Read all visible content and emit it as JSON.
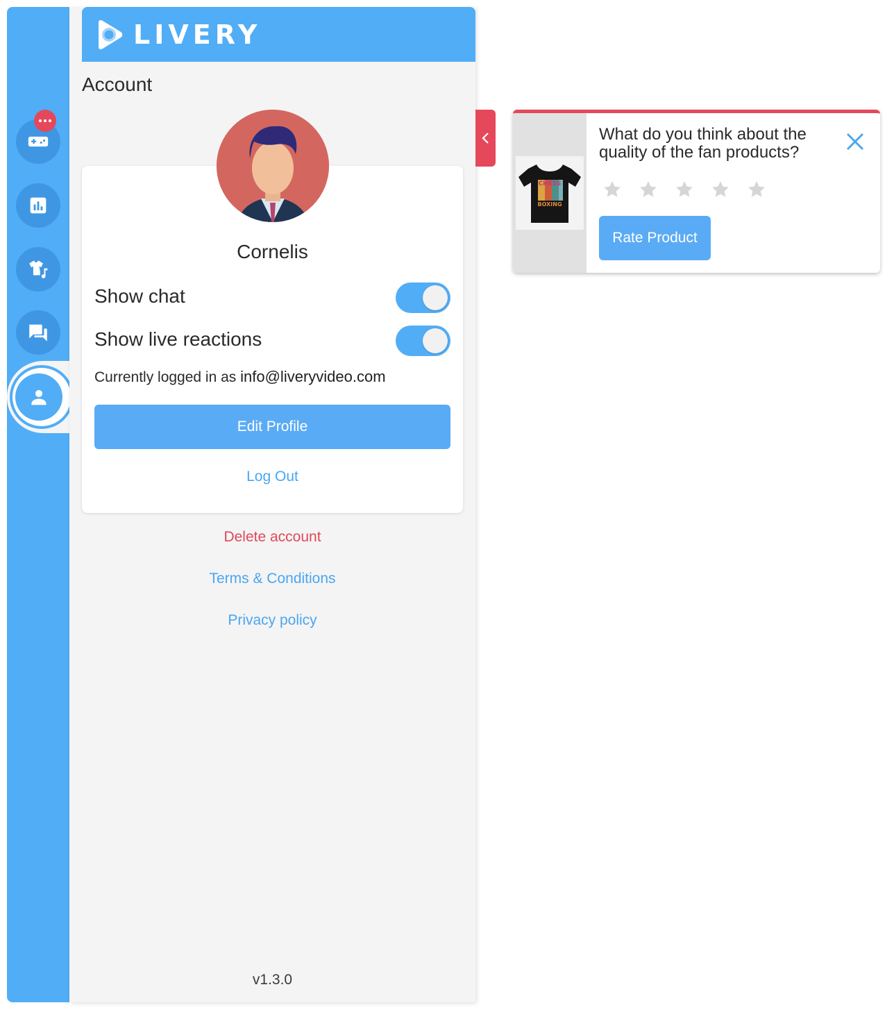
{
  "brand": {
    "name": "LIVERY"
  },
  "sidebar": {
    "badge": "•••",
    "items": [
      {
        "name": "games"
      },
      {
        "name": "stats"
      },
      {
        "name": "merch"
      },
      {
        "name": "chat"
      },
      {
        "name": "account"
      }
    ]
  },
  "account": {
    "title": "Account",
    "username": "Cornelis",
    "show_chat_label": "Show chat",
    "show_chat_on": true,
    "show_reactions_label": "Show live reactions",
    "show_reactions_on": true,
    "logged_in_prefix": "Currently logged in as",
    "email": "info@liveryvideo.com",
    "edit_profile": "Edit Profile",
    "log_out": "Log Out",
    "delete_account": "Delete account",
    "terms": "Terms & Conditions",
    "privacy": "Privacy policy",
    "version": "v1.3.0"
  },
  "popup": {
    "question": "What do you think about the quality of the fan products?",
    "product_text_top": "CHESS",
    "product_text_bottom": "BOXING",
    "rating": 0,
    "max_rating": 5,
    "rate_button": "Rate Product"
  },
  "colors": {
    "primary": "#51adf6",
    "accent_red": "#e5485b",
    "panel_bg": "#f4f4f4"
  }
}
